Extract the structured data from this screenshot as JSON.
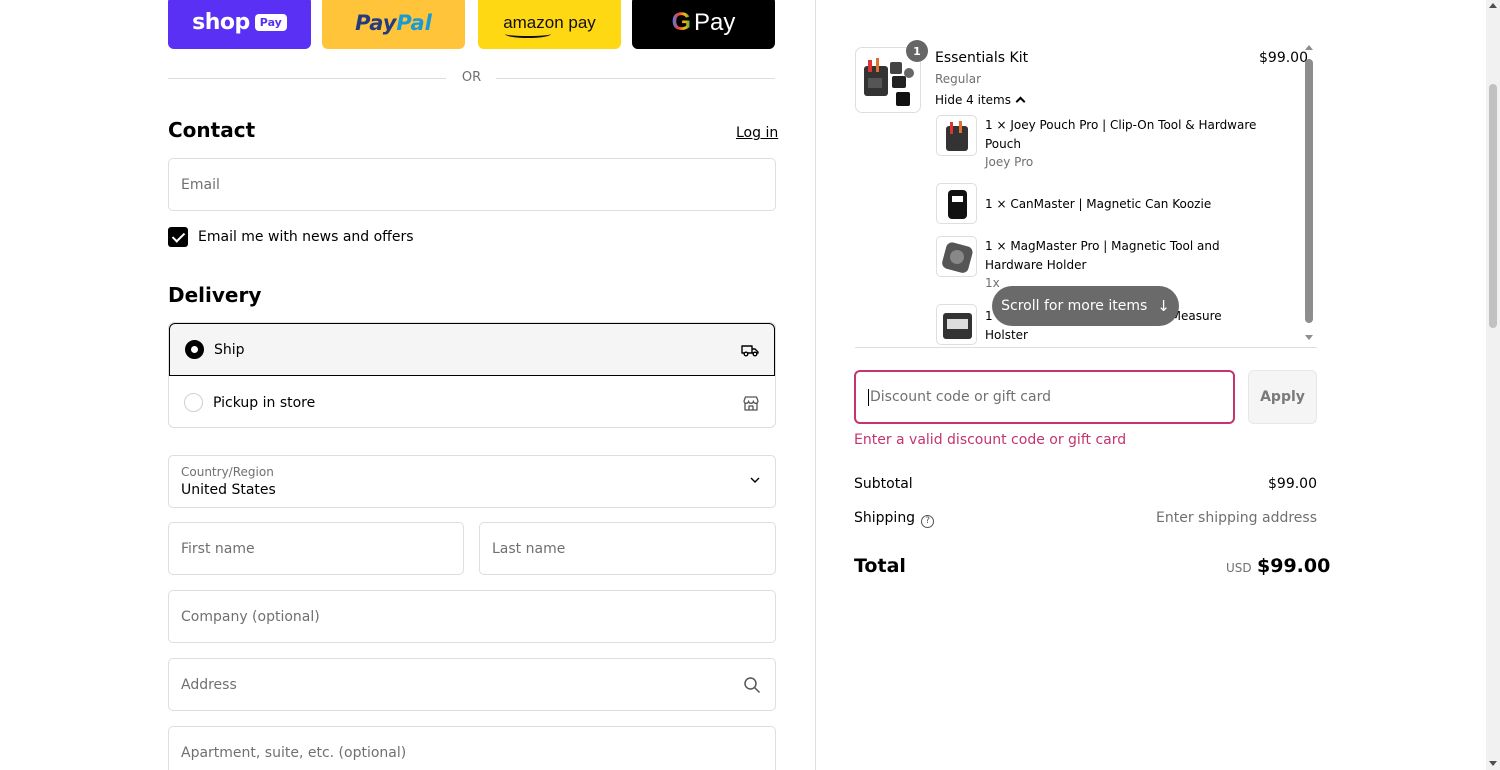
{
  "express": {
    "shop_pay": {
      "word": "shop",
      "pill": "Pay"
    },
    "paypal": {
      "part1": "Pay",
      "part2": "Pal"
    },
    "amazon_pay": {
      "label": "amazon pay"
    },
    "google_pay": {
      "g": "G",
      "label": "Pay"
    }
  },
  "or_label": "OR",
  "contact": {
    "heading": "Contact",
    "login": "Log in",
    "email_placeholder": "Email",
    "newsletter_label": "Email me with news and offers",
    "newsletter_checked": true
  },
  "delivery": {
    "heading": "Delivery",
    "options": [
      {
        "label": "Ship",
        "selected": true,
        "icon": "truck-icon"
      },
      {
        "label": "Pickup in store",
        "selected": false,
        "icon": "store-icon"
      }
    ],
    "country_label": "Country/Region",
    "country_value": "United States",
    "first_name": "First name",
    "last_name": "Last name",
    "company": "Company (optional)",
    "address": "Address",
    "apartment": "Apartment, suite, etc. (optional)"
  },
  "order": {
    "badge": "1",
    "title": "Essentials Kit",
    "variant": "Regular",
    "toggle": "Hide 4 items",
    "price": "$99.00",
    "items": [
      {
        "line1": "1 × Joey Pouch Pro | Clip-On Tool & Hardware",
        "line2": "Pouch",
        "sub": "Joey Pro"
      },
      {
        "line1": "1 × CanMaster | Magnetic Can Koozie",
        "line2": "",
        "sub": ""
      },
      {
        "line1": "1 × MagMaster Pro | Magnetic Tool and",
        "line2": "Hardware Holder",
        "sub": "1x"
      },
      {
        "line1": "1",
        "line1b": "Measure",
        "line2": "Holster",
        "sub": ""
      }
    ],
    "scroll_hint": "Scroll for more items"
  },
  "discount": {
    "placeholder": "Discount code or gift card",
    "apply": "Apply",
    "error": "Enter a valid discount code or gift card"
  },
  "summary": {
    "subtotal_label": "Subtotal",
    "subtotal_value": "$99.00",
    "shipping_label": "Shipping",
    "shipping_value": "Enter shipping address",
    "total_label": "Total",
    "currency": "USD",
    "total_value": "$99.00"
  },
  "colors": {
    "shop_pay": "#5a31f4",
    "paypal": "#ffc439",
    "amazon_pay": "#ffd814",
    "google_pay": "#000000",
    "error": "#c4346e"
  }
}
